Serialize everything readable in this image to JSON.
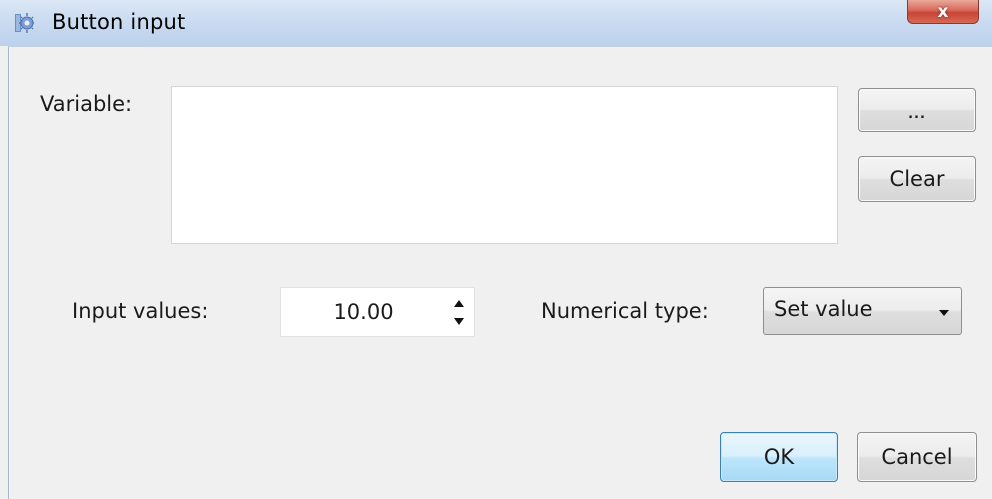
{
  "window": {
    "title": "Button input",
    "title_icon": "app-icon",
    "close_label": "x"
  },
  "variable": {
    "label": "Variable:",
    "value": "",
    "browse_label": "...",
    "clear_label": "Clear"
  },
  "input_values": {
    "label": "Input values:",
    "value": "10.00"
  },
  "numerical_type": {
    "label": "Numerical type:",
    "selected": "Set value"
  },
  "footer": {
    "ok_label": "OK",
    "cancel_label": "Cancel"
  },
  "colors": {
    "background": "#f0f0f0",
    "titlebar": "#c9daf0",
    "close_button": "#c84535",
    "ok_button": "#bee6fd"
  }
}
